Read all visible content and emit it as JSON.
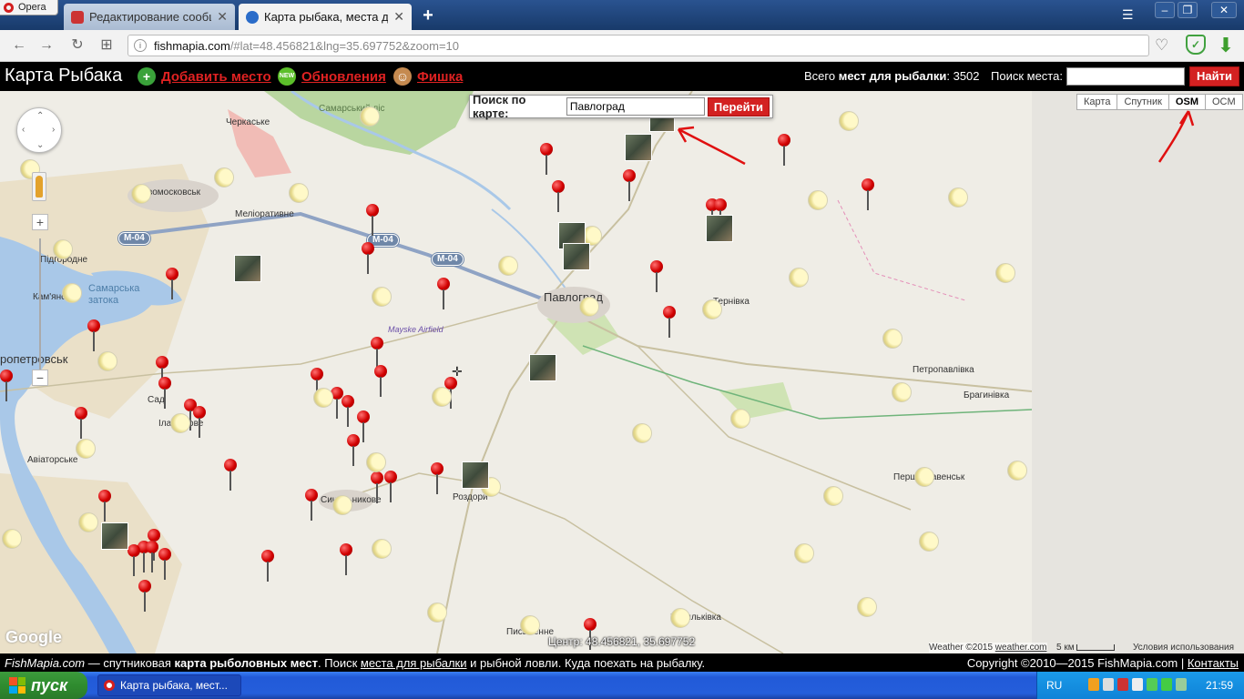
{
  "browser": {
    "opera_label": "Opera",
    "tabs": [
      {
        "title": "Редактирование сообщения",
        "close": "✕"
      },
      {
        "title": "Карта рыбака, места для рыбалки",
        "close": "✕"
      }
    ],
    "new_tab": "+",
    "url_domain": "fishmapia.com",
    "url_rest": "/#lat=48.456821&lng=35.697752&zoom=10",
    "extension_badge": "2"
  },
  "site": {
    "title": "Карта Рыбака",
    "links": {
      "add_place": "Добавить место",
      "updates": "Обновления",
      "feature": "Фишка"
    },
    "new_badge": "NEW",
    "totals_prefix": "Всего",
    "totals_bold": "мест для рыбалки",
    "totals_value": ": 3502",
    "search_label": "Поиск места:",
    "search_value": "",
    "find_button": "Найти"
  },
  "map": {
    "map_search_label": "Поиск по карте:",
    "map_search_value": "Павлоград",
    "go_button": "Перейти",
    "map_types": [
      "Карта",
      "Спутник",
      "OSM",
      "OCM"
    ],
    "active_map_type": "OSM",
    "zoom_in": "+",
    "zoom_out": "−",
    "labels": {
      "cherkaske": "Черкаське",
      "novomoskovsk": "вомосковськ",
      "meliorativne": "Меліоративне",
      "pidhorodne": "Підгородне",
      "samarska_zatoka": "Самарська затока",
      "kamianske": "Кам'янське",
      "dnipropetrovsk": "ропетровськ",
      "sad": "Сад",
      "ilarionove": "Іларіонове",
      "aviatorske": "Авіаторське",
      "pavlohrad": "Павлоград",
      "mayske": "Mayske Airfield",
      "ternivka": "Тернівка",
      "petropavlivka": "Петропавлівка",
      "brahynivka": "Брагинівка",
      "pershotravensk": "Першотравенськ",
      "rozdory": "Роздори",
      "synelnykove": "Синельникове",
      "pysmenne": "Письменне",
      "vasylkivka": "Васильківка",
      "samara_lis": "Самарський ліс"
    },
    "road_shields": [
      "M-04",
      "M-04",
      "M-04"
    ],
    "centre_text": "Центр: 48.456821, 35.697752",
    "google_logo": "Google",
    "weather_attrib": "Weather ©2015",
    "weather_link": "weather.com",
    "scale": "5 км",
    "terms": "Условия использования"
  },
  "footer": {
    "brand": "FishMapia.com",
    "text1": " — спутниковая ",
    "bold": "карта рыболовных мест",
    "text2": ". Поиск ",
    "link": "места для рыбалки",
    "text3": " и рыбной ловли. Куда поехать на рыбалку.",
    "copyright": "Copyright ©2010—2015 FishMapia.com | ",
    "contacts": "Контакты"
  },
  "taskbar": {
    "start": "пуск",
    "task": "Карта рыбака, мест...",
    "lang": "RU",
    "time": "21:59"
  },
  "colors": {
    "accent_red": "#d32121",
    "header_bg": "#000000",
    "taskbar_blue": "#245edb"
  }
}
